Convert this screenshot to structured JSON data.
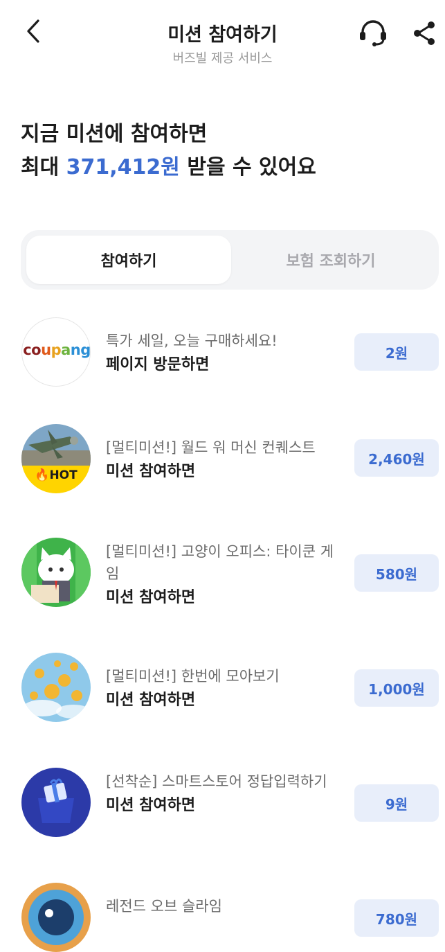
{
  "header": {
    "title": "미션 참여하기",
    "subtitle": "버즈빌 제공 서비스",
    "back_icon": "chevron-left-icon",
    "support_icon": "headset-icon",
    "share_icon": "share-icon"
  },
  "hero": {
    "line1": "지금 미션에 참여하면",
    "line2_prefix": "최대 ",
    "amount": "371,412원",
    "line2_suffix": " 받을 수 있어요"
  },
  "tabs": {
    "active": "참여하기",
    "inactive": "보험 조회하기"
  },
  "missions": [
    {
      "desc": "특가 세일, 오늘 구매하세요!",
      "cta": "페이지 방문하면",
      "reward": "2원",
      "thumb_text": "coupang"
    },
    {
      "desc": "[멀티미션!] 월드 워 머신 컨퀘스트",
      "cta": "미션 참여하면",
      "reward": "2,460원",
      "badge": "HOT"
    },
    {
      "desc": "[멀티미션!] 고양이 오피스: 타이쿤 게임",
      "cta": "미션 참여하면",
      "reward": "580원"
    },
    {
      "desc": "[멀티미션!] 한번에 모아보기",
      "cta": "미션 참여하면",
      "reward": "1,000원"
    },
    {
      "desc": "[선착순] 스마트스토어 정답입력하기",
      "cta": "미션 참여하면",
      "reward": "9원"
    },
    {
      "desc": "레전드 오브 슬라임",
      "cta": "",
      "reward": "780원"
    }
  ],
  "colors": {
    "accent": "#3b6bd0",
    "reward_bg": "#e8eefa",
    "hot_badge": "#ffd400"
  }
}
